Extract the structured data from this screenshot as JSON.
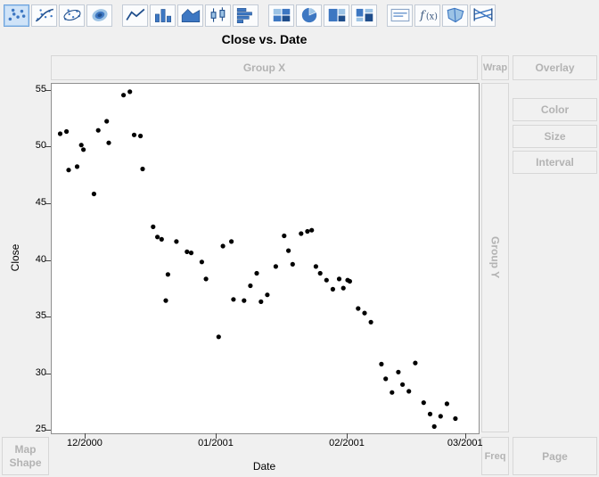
{
  "window": {
    "app": "Graph Builder"
  },
  "toolbar": {
    "icons": [
      {
        "name": "points",
        "selected": true,
        "group": 1
      },
      {
        "name": "smoother",
        "selected": false,
        "group": 1
      },
      {
        "name": "ellipse",
        "selected": false,
        "group": 1
      },
      {
        "name": "contour",
        "selected": false,
        "group": 1
      },
      {
        "name": "line",
        "selected": false,
        "group": 2
      },
      {
        "name": "bar",
        "selected": false,
        "group": 2
      },
      {
        "name": "area",
        "selected": false,
        "group": 2
      },
      {
        "name": "box-plot",
        "selected": false,
        "group": 2
      },
      {
        "name": "histogram",
        "selected": false,
        "group": 2
      },
      {
        "name": "heatmap",
        "selected": false,
        "group": 3
      },
      {
        "name": "pie",
        "selected": false,
        "group": 3
      },
      {
        "name": "treemap",
        "selected": false,
        "group": 3
      },
      {
        "name": "mosaic",
        "selected": false,
        "group": 3
      },
      {
        "name": "caption-box",
        "selected": false,
        "group": 4
      },
      {
        "name": "formula",
        "selected": false,
        "group": 4
      },
      {
        "name": "map-shapes",
        "selected": false,
        "group": 4
      },
      {
        "name": "parallel",
        "selected": false,
        "group": 4
      }
    ]
  },
  "zones": {
    "group_x": "Group X",
    "wrap": "Wrap",
    "overlay": "Overlay",
    "color": "Color",
    "size": "Size",
    "interval": "Interval",
    "group_y": "Group Y",
    "map_shape": "Map Shape",
    "freq": "Freq",
    "page": "Page"
  },
  "chart_data": {
    "type": "scatter",
    "title": "Close vs. Date",
    "xlabel": "Date",
    "ylabel": "Close",
    "point_color": "#000000",
    "x_tick_labels": [
      "12/2000",
      "01/2001",
      "02/2001",
      "03/2001"
    ],
    "x_tick_days": [
      0,
      31,
      62,
      90
    ],
    "x_range_days": [
      -8,
      93
    ],
    "y_ticks": [
      25,
      30,
      35,
      40,
      45,
      50,
      55
    ],
    "y_range": [
      24.8,
      55.6
    ],
    "grid": false,
    "columns": [
      "days_since_12_2000",
      "close"
    ],
    "points": [
      [
        -6,
        51.2
      ],
      [
        -4.5,
        51.4
      ],
      [
        -4,
        48.0
      ],
      [
        -2,
        48.3
      ],
      [
        -1,
        50.2
      ],
      [
        -0.5,
        49.8
      ],
      [
        2,
        45.9
      ],
      [
        3,
        51.5
      ],
      [
        5,
        52.3
      ],
      [
        5.5,
        50.4
      ],
      [
        9,
        54.6
      ],
      [
        10.5,
        54.9
      ],
      [
        11.5,
        51.1
      ],
      [
        13,
        51.0
      ],
      [
        13.5,
        48.1
      ],
      [
        16,
        43.0
      ],
      [
        17,
        42.1
      ],
      [
        18,
        41.9
      ],
      [
        19,
        36.5
      ],
      [
        19.5,
        38.8
      ],
      [
        21.5,
        41.7
      ],
      [
        24,
        40.8
      ],
      [
        25,
        40.7
      ],
      [
        27.5,
        39.9
      ],
      [
        28.5,
        38.4
      ],
      [
        31.5,
        33.3
      ],
      [
        32.5,
        41.3
      ],
      [
        34.5,
        41.7
      ],
      [
        35,
        36.6
      ],
      [
        37.5,
        36.5
      ],
      [
        39,
        37.8
      ],
      [
        40.5,
        38.9
      ],
      [
        41.5,
        36.4
      ],
      [
        43,
        37.0
      ],
      [
        45,
        39.5
      ],
      [
        47,
        42.2
      ],
      [
        48,
        40.9
      ],
      [
        49,
        39.7
      ],
      [
        51,
        42.4
      ],
      [
        52.5,
        42.6
      ],
      [
        53.5,
        42.7
      ],
      [
        54.5,
        39.5
      ],
      [
        55.5,
        38.9
      ],
      [
        57,
        38.3
      ],
      [
        58.5,
        37.5
      ],
      [
        60,
        38.4
      ],
      [
        61,
        37.6
      ],
      [
        62,
        38.3
      ],
      [
        62.5,
        38.2
      ],
      [
        64.5,
        35.8
      ],
      [
        66,
        35.4
      ],
      [
        67.5,
        34.6
      ],
      [
        70,
        30.9
      ],
      [
        71,
        29.6
      ],
      [
        72.5,
        28.4
      ],
      [
        74,
        30.2
      ],
      [
        75,
        29.1
      ],
      [
        76.5,
        28.5
      ],
      [
        78,
        31.0
      ],
      [
        80,
        27.5
      ],
      [
        81.5,
        26.5
      ],
      [
        82.5,
        25.4
      ],
      [
        84,
        26.3
      ],
      [
        85.5,
        27.4
      ],
      [
        87.5,
        26.1
      ]
    ]
  }
}
